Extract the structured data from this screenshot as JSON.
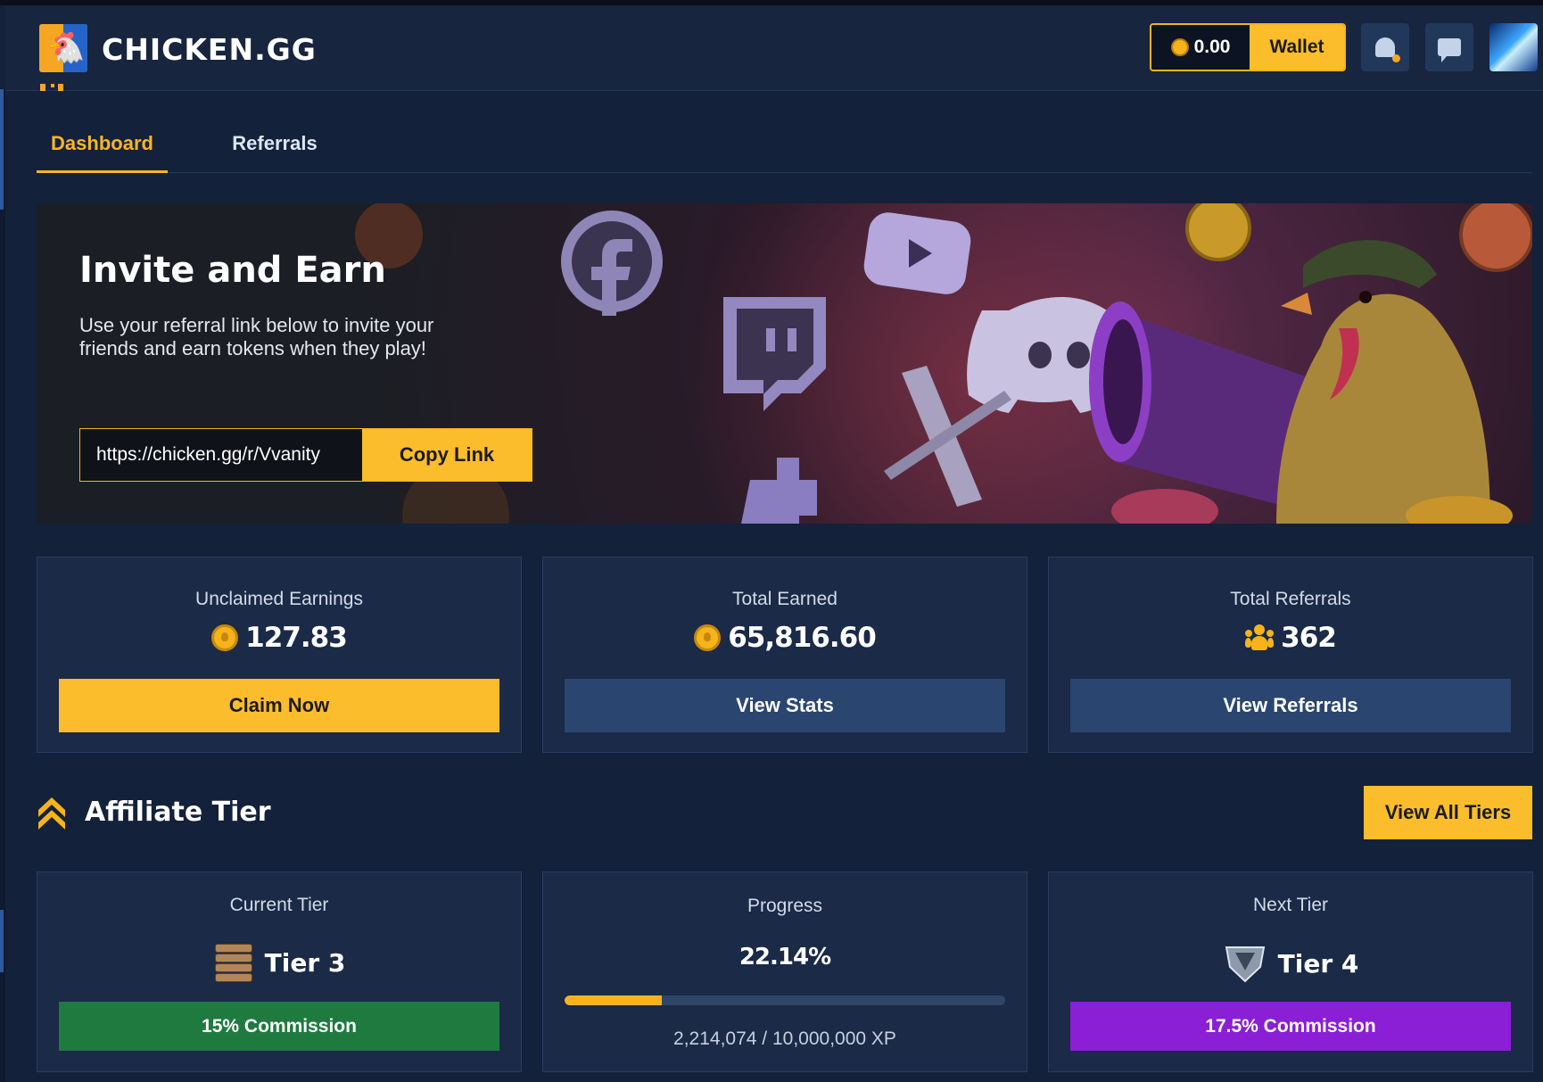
{
  "header": {
    "brand": "CHICKEN.GG",
    "wallet_balance": "0.00",
    "wallet_label": "Wallet"
  },
  "tabs": [
    {
      "label": "Dashboard",
      "active": true
    },
    {
      "label": "Referrals",
      "active": false
    }
  ],
  "banner": {
    "title": "Invite and Earn",
    "subtitle": "Use your referral link below to invite your friends and earn tokens when they play!",
    "referral_link": "https://chicken.gg/r/Vvanity",
    "copy_label": "Copy Link"
  },
  "stats": [
    {
      "label": "Unclaimed Earnings",
      "value": "127.83",
      "icon": "coin-icon",
      "button": "Claim Now"
    },
    {
      "label": "Total Earned",
      "value": "65,816.60",
      "icon": "coin-icon",
      "button": "View Stats"
    },
    {
      "label": "Total Referrals",
      "value": "362",
      "icon": "people-icon",
      "button": "View Referrals"
    }
  ],
  "affiliate": {
    "title": "Affiliate Tier",
    "view_all_label": "View All Tiers",
    "current": {
      "label": "Current Tier",
      "tier": "Tier 3",
      "commission": "15% Commission"
    },
    "progress": {
      "label": "Progress",
      "percent": "22.14%",
      "fraction": 0.2214,
      "xp": "2,214,074 / 10,000,000 XP"
    },
    "next": {
      "label": "Next Tier",
      "tier": "Tier 4",
      "commission": "17.5% Commission"
    }
  },
  "colors": {
    "accent": "#fbbd2b",
    "background": "#14213a",
    "card": "#1a2a47",
    "button_blue": "#2a4670",
    "commission_green": "#1f7a3f",
    "commission_purple": "#8a1fd6"
  }
}
